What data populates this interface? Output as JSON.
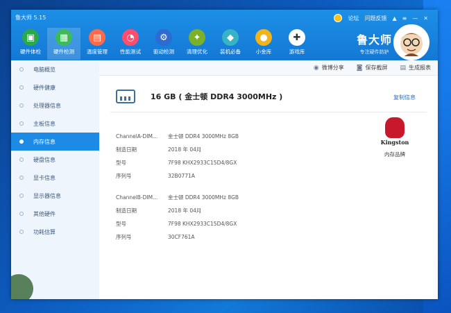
{
  "app": {
    "title": "鲁大师 5.15"
  },
  "top_links": [
    "论坛",
    "问题反馈"
  ],
  "tools": [
    {
      "label": "硬件体检",
      "icon": "monitor-icon",
      "color": "#28a745"
    },
    {
      "label": "硬件检测",
      "icon": "chip-icon",
      "color": "#3dbb59"
    },
    {
      "label": "温度管理",
      "icon": "chart-icon",
      "color": "#ff6b4a"
    },
    {
      "label": "性能测试",
      "icon": "speedometer-icon",
      "color": "#ff4d6d"
    },
    {
      "label": "驱动检测",
      "icon": "gear-icon",
      "color": "#2d6bd1"
    },
    {
      "label": "清理优化",
      "icon": "broom-icon",
      "color": "#7bb02b"
    },
    {
      "label": "装机必备",
      "icon": "cube-icon",
      "color": "#36b3c4"
    },
    {
      "label": "小金库",
      "icon": "gold-icon",
      "color": "#f2b31b"
    },
    {
      "label": "游戏库",
      "icon": "gamepad-icon",
      "color": "#ffffff"
    }
  ],
  "brand": {
    "name": "鲁大师",
    "slogan": "专注硬件防护"
  },
  "sidebar": {
    "items": [
      {
        "label": "电脑概览"
      },
      {
        "label": "硬件健康"
      },
      {
        "label": "处理器信息"
      },
      {
        "label": "主板信息"
      },
      {
        "label": "内存信息"
      },
      {
        "label": "硬盘信息"
      },
      {
        "label": "显卡信息"
      },
      {
        "label": "显示器信息"
      },
      {
        "label": "其他硬件"
      },
      {
        "label": "功耗估算"
      }
    ],
    "active_index": 4
  },
  "actions": [
    {
      "label": "微博分享",
      "icon": "share-icon"
    },
    {
      "label": "保存截屏",
      "icon": "camera-icon"
    },
    {
      "label": "生成报表",
      "icon": "report-icon"
    }
  ],
  "summary": {
    "title": "16 GB ( 金士顿 DDR4 3000MHz )",
    "copy_label": "复制信息"
  },
  "groups": [
    {
      "rows": [
        {
          "key": "ChannelA-DIM...",
          "value": "金士顿 DDR4 3000MHz 8GB"
        },
        {
          "key": "制造日期",
          "value": "2018 年 04月"
        },
        {
          "key": "型号",
          "value": "7F98 KHX2933C15D4/8GX"
        },
        {
          "key": "序列号",
          "value": "32B0771A"
        }
      ]
    },
    {
      "rows": [
        {
          "key": "ChannelB-DIM...",
          "value": "金士顿 DDR4 3000MHz 8GB"
        },
        {
          "key": "制造日期",
          "value": "2018 年 04月"
        },
        {
          "key": "型号",
          "value": "7F98 KHX2933C15D4/8GX"
        },
        {
          "key": "序列号",
          "value": "30CF761A"
        }
      ]
    }
  ],
  "brand_logo": {
    "text": "Kingston",
    "caption": "内存品牌"
  }
}
